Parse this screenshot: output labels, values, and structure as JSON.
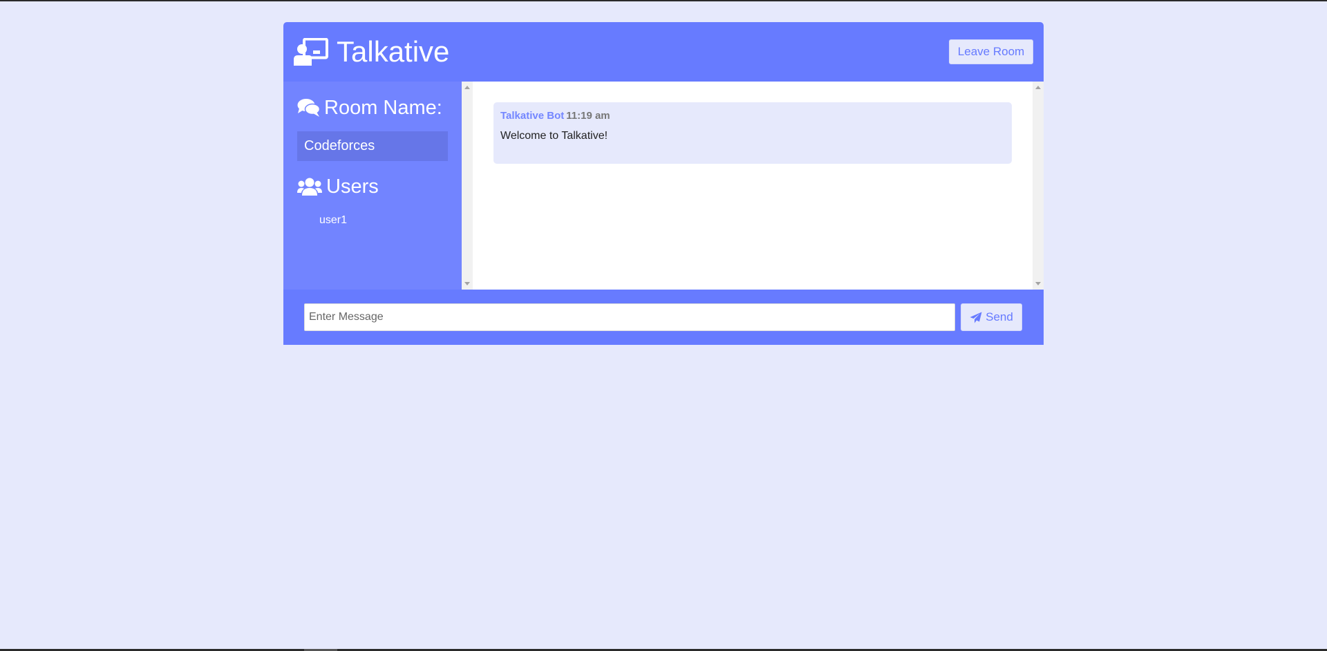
{
  "app": {
    "title": "Talkative",
    "icon": "chalkboard-teacher-icon"
  },
  "header": {
    "leave_label": "Leave Room"
  },
  "sidebar": {
    "room_heading": "Room Name:",
    "room_name": "Codeforces",
    "users_heading": "Users",
    "users": [
      "user1"
    ]
  },
  "messages": [
    {
      "username": "Talkative Bot",
      "time": "11:19 am",
      "text": "Welcome to Talkative!"
    }
  ],
  "form": {
    "placeholder": "Enter Message",
    "send_label": "Send"
  },
  "colors": {
    "background": "#e6e9fc",
    "primary": "#677bff",
    "sidebar": "#7284ff",
    "accent": "#667aff"
  }
}
